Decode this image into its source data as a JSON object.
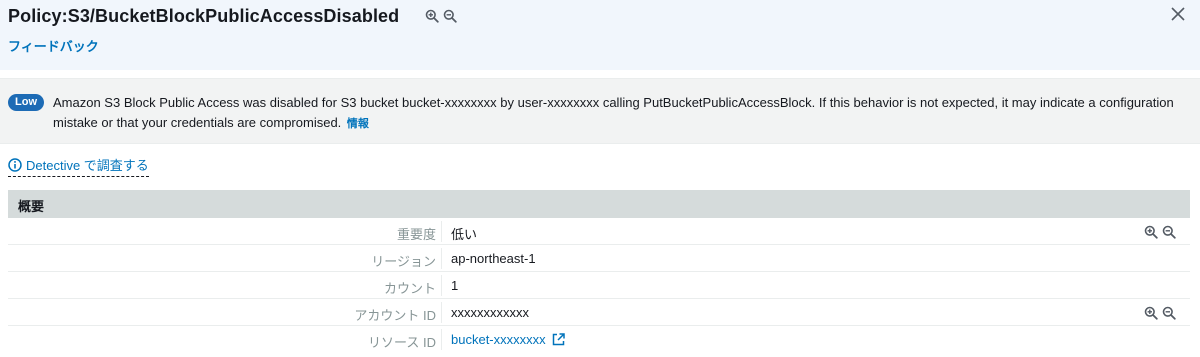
{
  "header": {
    "title": "Policy:S3/BucketBlockPublicAccessDisabled",
    "feedback_label": "フィードバック"
  },
  "finding": {
    "severity_badge": "Low",
    "description": "Amazon S3 Block Public Access was disabled for S3 bucket bucket-xxxxxxxx by user-xxxxxxxx calling PutBucketPublicAccessBlock. If this behavior is not expected, it may indicate a configuration mistake or that your credentials are compromised.",
    "info_link": "情報",
    "badge_color": "#1d6bb5"
  },
  "detective": {
    "label": "Detective で調査する",
    "icon": "info-circle-icon"
  },
  "overview": {
    "title": "概要",
    "rows": [
      {
        "key": "重要度",
        "value": "低い",
        "has_zoom": true
      },
      {
        "key": "リージョン",
        "value": "ap-northeast-1",
        "has_zoom": false
      },
      {
        "key": "カウント",
        "value": "1",
        "has_zoom": false
      },
      {
        "key": "アカウント ID",
        "value": "xxxxxxxxxxxx",
        "has_zoom": true
      },
      {
        "key": "リソース ID",
        "value": "bucket-xxxxxxxx",
        "has_zoom": false,
        "is_link": true,
        "icon": "external-link-icon"
      }
    ]
  },
  "colors": {
    "link": "#0073bb",
    "header_bg": "#f1f6fc",
    "table_head_bg": "#d5dbdb"
  }
}
